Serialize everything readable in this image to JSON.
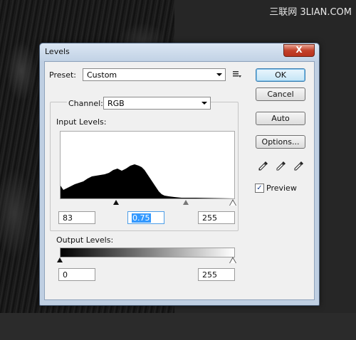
{
  "watermark": "三联网 3LIAN.COM",
  "window": {
    "title": "Levels",
    "close_glyph": "X"
  },
  "preset": {
    "label": "Preset:",
    "value": "Custom"
  },
  "channel": {
    "label": "Channel:",
    "value": "RGB"
  },
  "input_levels": {
    "label": "Input Levels:",
    "black": "83",
    "gamma": "0.75",
    "white": "255"
  },
  "output_levels": {
    "label": "Output Levels:",
    "black": "0",
    "white": "255"
  },
  "buttons": {
    "ok": "OK",
    "cancel": "Cancel",
    "auto": "Auto",
    "options": "Options..."
  },
  "preview": {
    "label": "Preview",
    "checked": true,
    "check_glyph": "✓"
  },
  "icons": [
    "preset-menu-icon",
    "black-eyedropper-icon",
    "gray-eyedropper-icon",
    "white-eyedropper-icon"
  ]
}
